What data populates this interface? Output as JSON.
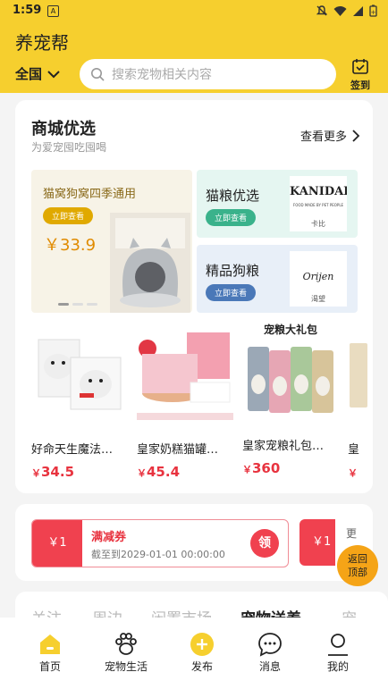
{
  "status_bar": {
    "time": "1:59",
    "notif_icon": "A"
  },
  "header": {
    "title": "养宠帮",
    "region": "全国",
    "search_placeholder": "搜索宠物相关内容",
    "checkin_label": "签到"
  },
  "mall": {
    "title": "商城优选",
    "subtitle": "为爱宠囤吃囤喝",
    "more_label": "查看更多",
    "banner_main": {
      "title": "猫窝狗窝四季通用",
      "button": "立即查看",
      "price": "￥33.9"
    },
    "banner_cat_food": {
      "title": "猫粮优选",
      "button": "立即查看",
      "brand_logo": "KANIDAE",
      "brand_tag": "FOOD MADE BY PET PEOPLE",
      "brand_name": "卡比"
    },
    "banner_dog_food": {
      "title": "精品狗粮",
      "button": "立即查看",
      "brand_logo": "Orijen",
      "brand_name": "渴望"
    },
    "products": [
      {
        "name": "好命天生魔法…",
        "price": "34.5"
      },
      {
        "name": "皇家奶糕猫罐…",
        "price": "45.4"
      },
      {
        "name": "皇家宠粮礼包…",
        "price": "360",
        "image_caption": "宠粮大礼包"
      },
      {
        "name": "皇",
        "price": ""
      }
    ],
    "currency": "￥"
  },
  "coupon": {
    "amount": "￥1",
    "title": "满减券",
    "expiry": "截至到2029-01-01 00:00:00",
    "claim_label": "领",
    "next_amount": "￥1",
    "more_label": "更"
  },
  "back_to_top": {
    "line1": "返回",
    "line2": "顶部"
  },
  "feed_tabs": [
    "关注",
    "周边",
    "闲置市场",
    "宠物送养",
    "宠"
  ],
  "bottom_nav": [
    {
      "label": "首页",
      "icon": "home-icon"
    },
    {
      "label": "宠物生活",
      "icon": "paw-icon"
    },
    {
      "label": "发布",
      "icon": "publish-icon"
    },
    {
      "label": "消息",
      "icon": "message-icon"
    },
    {
      "label": "我的",
      "icon": "profile-icon"
    }
  ],
  "colors": {
    "brand_yellow": "#f6cf2e",
    "price_red": "#e8333f",
    "coupon_red": "#f0414f",
    "back_top_orange": "#f5a417"
  }
}
